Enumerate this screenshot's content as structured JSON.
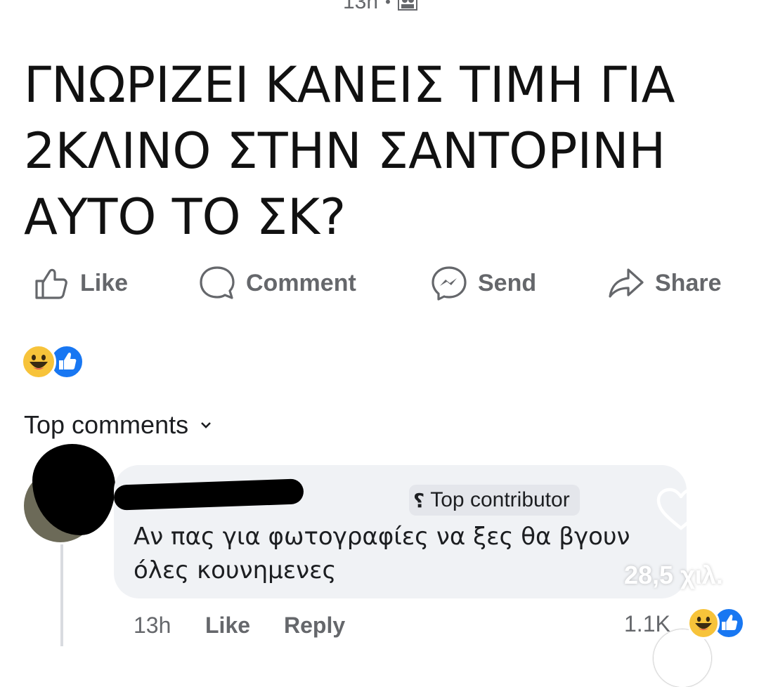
{
  "header": {
    "time": "13h",
    "separator": "•",
    "audience_icon": "friends-icon"
  },
  "post": {
    "lines": [
      "ΓΝΩΡΙΖΕΙ ΚΑΝΕΙΣ ΤΙΜΗ ΓΙΑ",
      "2ΚΛΙΝΟ ΣΤΗΝ ΣΑΝΤΟΡΙΝΗ",
      "ΑΥΤΟ ΤΟ ΣΚ?"
    ]
  },
  "actions": {
    "like": "Like",
    "comment": "Comment",
    "send": "Send",
    "share": "Share"
  },
  "post_reactions": [
    "haha",
    "like"
  ],
  "comments_section": {
    "sort_label": "Top comments"
  },
  "comment": {
    "badge": "Top contributor",
    "text_lines": [
      "Αν πας για φωτογραφίες να ξες θα βγουν",
      "όλες κουνημενες"
    ],
    "overlay_views": "28,5 χιλ.",
    "time": "13h",
    "like_label": "Like",
    "reply_label": "Reply",
    "reaction_count": "1.1K"
  },
  "colors": {
    "like_blue": "#1877f2",
    "haha_yellow": "#f7c33a",
    "bubble_bg": "#f0f2f5",
    "muted_text": "#65676b"
  }
}
